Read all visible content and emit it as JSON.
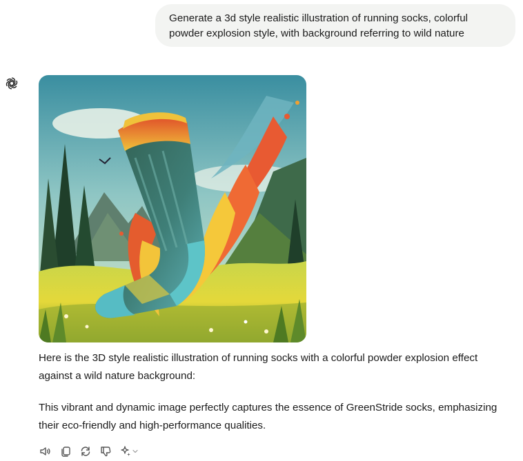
{
  "user_message": "Generate a 3d style realistic illustration of running socks, colorful powder explosion style, with background referring to wild nature",
  "assistant": {
    "avatar_icon": "openai-logo-icon",
    "image_subject": "running sock with colorful powder explosion in wild nature",
    "paragraphs": [
      "Here is the 3D style realistic illustration of running socks with a colorful powder explosion effect against a wild nature background:",
      "This vibrant and dynamic image perfectly captures the essence of GreenStride socks, emphasizing their eco-friendly and high-performance qualities."
    ]
  },
  "actions": [
    {
      "name": "read-aloud",
      "icon": "speaker-icon"
    },
    {
      "name": "copy",
      "icon": "copy-icon"
    },
    {
      "name": "regenerate",
      "icon": "refresh-icon"
    },
    {
      "name": "bad-response",
      "icon": "thumbs-down-icon"
    },
    {
      "name": "change-model",
      "icon": "sparkle-icon"
    }
  ],
  "colors": {
    "user_bubble": "#f3f4f2",
    "text": "#1a1a1a",
    "icon": "#555555"
  }
}
